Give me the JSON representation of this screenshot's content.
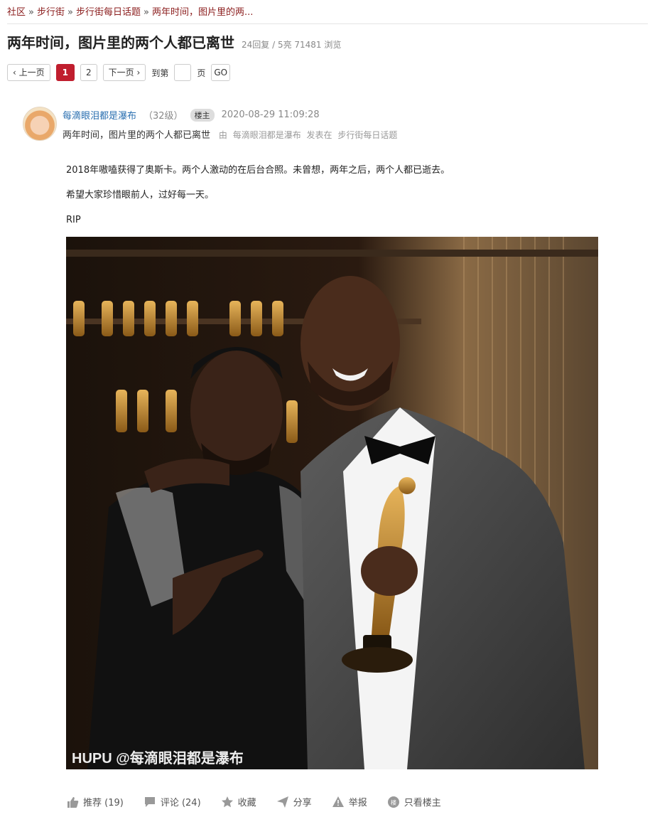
{
  "breadcrumb": {
    "items": [
      "社区",
      "步行街",
      "步行街每日话题",
      "两年时间，图片里的两..."
    ],
    "separator": "»"
  },
  "thread": {
    "title": "两年时间，图片里的两个人都已离世",
    "meta": "24回复 / 5亮 71481 浏览"
  },
  "pager": {
    "prev": "上一页",
    "pages": [
      "1",
      "2"
    ],
    "active_page": "1",
    "next": "下一页",
    "goto_label": "到第",
    "page_suffix": "页",
    "go": "GO"
  },
  "post": {
    "author": "每滴眼泪都是瀑布",
    "level": "（32级）",
    "badge": "楼主",
    "time": "2020-08-29 11:09:28",
    "subtitle": "两年时间，图片里的两个人都已离世",
    "by": "由",
    "by_author": "每滴眼泪都是瀑布",
    "posted_in": "发表在",
    "board": "步行街每日话题",
    "paragraphs": [
      "2018年嗷嗑获得了奥斯卡。两个人激动的在后台合照。未曾想，两年之后，两个人都已逝去。",
      "希望大家珍惜眼前人，过好每一天。",
      "RIP"
    ],
    "image_watermark": "HUPU @每滴眼泪都是瀑布"
  },
  "actions": {
    "recommend": "推荐 (19)",
    "comment": "评论 (24)",
    "favorite": "收藏",
    "share": "分享",
    "report": "举报",
    "only_op": "只看楼主"
  },
  "colors": {
    "link_red": "#8b1d1d",
    "author_blue": "#2a6fb0",
    "active_page": "#c01e2e"
  }
}
